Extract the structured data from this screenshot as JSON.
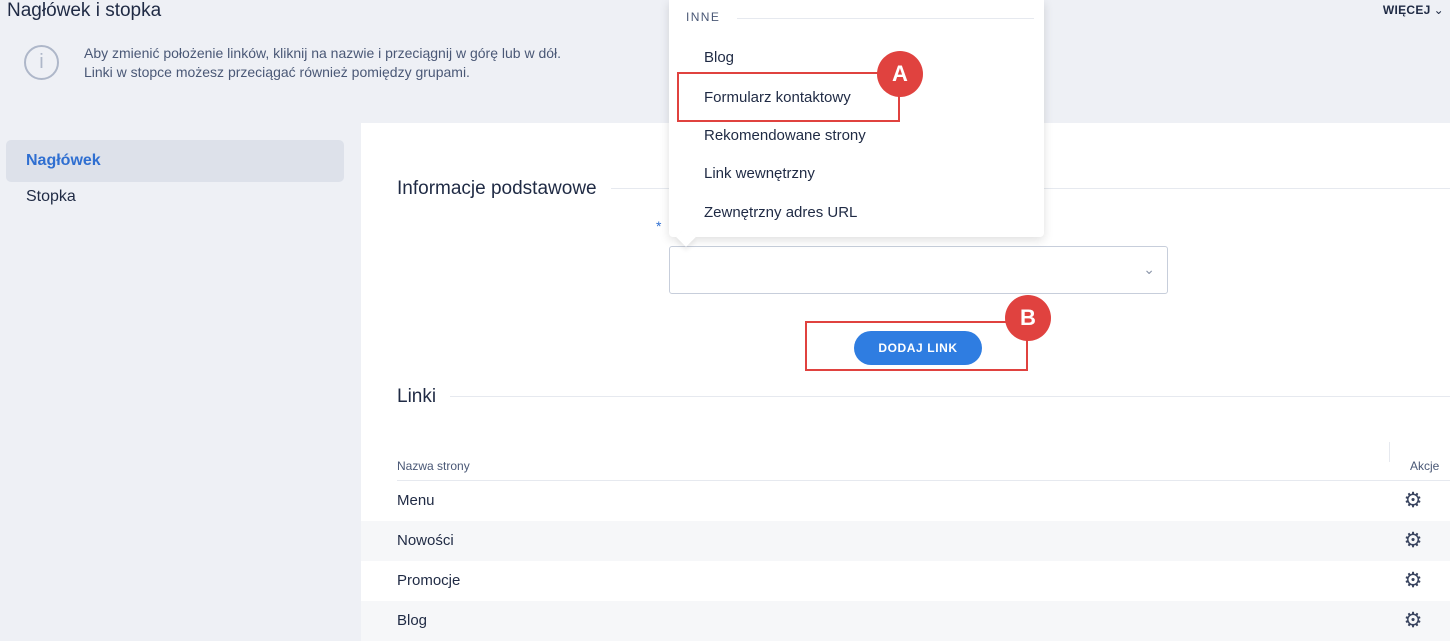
{
  "header": {
    "title": "Nagłówek i stopka",
    "more_label": "WIĘCEJ",
    "more_icon": "chevron-down-icon"
  },
  "info": {
    "icon": "info-icon",
    "line1": "Aby zmienić położenie linków, kliknij na nazwie i przeciągnij w górę lub w dół.",
    "line2": "Linki w stopce możesz przeciągać również pomiędzy grupami."
  },
  "sidebar": {
    "items": [
      {
        "label": "Nagłówek",
        "active": true
      },
      {
        "label": "Stopka",
        "active": false
      }
    ]
  },
  "basic_info": {
    "title": "Informacje podstawowe",
    "required_mark": "*",
    "select_value": "",
    "add_button": "DODAJ LINK"
  },
  "dropdown": {
    "group_label": "INNE",
    "options": [
      "Blog",
      "Formularz kontaktowy",
      "Rekomendowane strony",
      "Link wewnętrzny",
      "Zewnętrzny adres URL"
    ]
  },
  "links": {
    "title": "Linki",
    "columns": {
      "name": "Nazwa strony",
      "actions": "Akcje"
    },
    "rows": [
      {
        "name": "Menu"
      },
      {
        "name": "Nowości"
      },
      {
        "name": "Promocje"
      },
      {
        "name": "Blog"
      }
    ]
  },
  "annotations": {
    "a": "A",
    "b": "B"
  },
  "colors": {
    "accent": "#2f7de1",
    "highlight": "#e0423f",
    "active_text": "#2f6fd1"
  }
}
